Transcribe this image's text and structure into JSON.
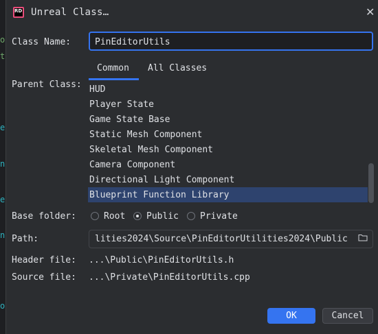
{
  "window": {
    "logo_text": "RD",
    "title": "Unreal Class…",
    "close_glyph": "✕"
  },
  "form": {
    "class_name_label": "Class Name:",
    "class_name_value": "PinEditorUtils",
    "parent_class_label": "Parent Class:",
    "tabs": [
      {
        "label": "Common",
        "active": true
      },
      {
        "label": "All Classes",
        "active": false
      }
    ],
    "parent_classes": [
      {
        "label": "HUD",
        "selected": false
      },
      {
        "label": "Player State",
        "selected": false
      },
      {
        "label": "Game State Base",
        "selected": false
      },
      {
        "label": "Static Mesh Component",
        "selected": false
      },
      {
        "label": "Skeletal Mesh Component",
        "selected": false
      },
      {
        "label": "Camera Component",
        "selected": false
      },
      {
        "label": "Directional Light Component",
        "selected": false
      },
      {
        "label": "Blueprint Function Library",
        "selected": true
      }
    ],
    "base_folder_label": "Base folder:",
    "base_folder_options": [
      {
        "label": "Root",
        "checked": false
      },
      {
        "label": "Public",
        "checked": true
      },
      {
        "label": "Private",
        "checked": false
      }
    ],
    "path_label": "Path:",
    "path_value": "lities2024\\Source\\PinEditorUtilities2024\\Public",
    "header_file_label": "Header file:",
    "header_file_value": "...\\Public\\PinEditorUtils.h",
    "source_file_label": "Source file:",
    "source_file_value": "...\\Private\\PinEditorUtils.cpp"
  },
  "buttons": {
    "ok_label": "OK",
    "cancel_label": "Cancel"
  },
  "colors": {
    "accent": "#3574f0",
    "selection": "#2e436e",
    "background": "#2b2d30"
  }
}
